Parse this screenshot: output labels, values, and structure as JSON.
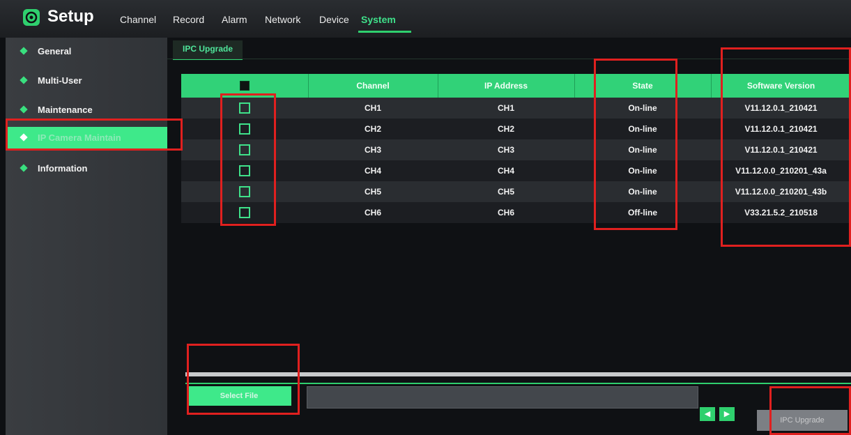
{
  "app": {
    "title": "Setup"
  },
  "menu": [
    {
      "label": "Channel"
    },
    {
      "label": "Record"
    },
    {
      "label": "Alarm"
    },
    {
      "label": "Network"
    },
    {
      "label": "Device"
    },
    {
      "label": "System",
      "active": true
    }
  ],
  "sidebar": {
    "items": [
      {
        "label": "General"
      },
      {
        "label": "Multi-User"
      },
      {
        "label": "Maintenance"
      },
      {
        "label": "IP Camera Maintain",
        "active": true
      },
      {
        "label": "Information"
      }
    ]
  },
  "tabs": [
    {
      "label": "IPC Upgrade",
      "active": true
    }
  ],
  "table": {
    "columns": [
      "",
      "Channel",
      "IP Address",
      "State",
      "Software Version"
    ],
    "rows": [
      {
        "channel": "CH1",
        "ip": "CH1",
        "state": "On-line",
        "version": "V11.12.0.1_210421"
      },
      {
        "channel": "CH2",
        "ip": "CH2",
        "state": "On-line",
        "version": "V11.12.0.1_210421"
      },
      {
        "channel": "CH3",
        "ip": "CH3",
        "state": "On-line",
        "version": "V11.12.0.1_210421"
      },
      {
        "channel": "CH4",
        "ip": "CH4",
        "state": "On-line",
        "version": "V11.12.0.0_210201_43a"
      },
      {
        "channel": "CH5",
        "ip": "CH5",
        "state": "On-line",
        "version": "V11.12.0.0_210201_43b"
      },
      {
        "channel": "CH6",
        "ip": "CH6",
        "state": "Off-line",
        "version": "V33.21.5.2_210518"
      }
    ]
  },
  "footer": {
    "select_file_label": "Select File",
    "file_path": "",
    "prev_icon": "triangle-left-icon",
    "next_icon": "triangle-right-icon",
    "upgrade_label": "IPC Upgrade"
  },
  "colors": {
    "accent": "#31d278",
    "annotation": "#e0201f"
  }
}
